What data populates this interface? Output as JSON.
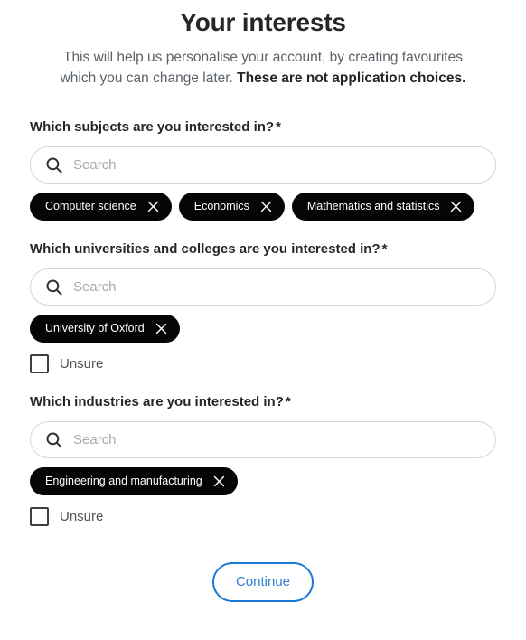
{
  "header": {
    "title": "Your interests",
    "subtitle_normal": "This will help us personalise your account, by creating favourites which you can change later. ",
    "subtitle_strong": "These are not application choices."
  },
  "sections": [
    {
      "label": "Which subjects are you interested in?",
      "required_marker": "*",
      "search": {
        "placeholder": "Search",
        "value": "",
        "icon": "search-icon"
      },
      "chips": [
        {
          "label": "Computer science",
          "remove_icon": "close-icon"
        },
        {
          "label": "Economics",
          "remove_icon": "close-icon"
        },
        {
          "label": "Mathematics and statistics",
          "remove_icon": "close-icon"
        }
      ],
      "unsure": null
    },
    {
      "label": "Which universities and colleges are you interested in?",
      "required_marker": "*",
      "search": {
        "placeholder": "Search",
        "value": "",
        "icon": "search-icon"
      },
      "chips": [
        {
          "label": "University of Oxford",
          "remove_icon": "close-icon"
        }
      ],
      "unsure": {
        "label": "Unsure",
        "checked": false
      }
    },
    {
      "label": "Which industries are you interested in?",
      "required_marker": "*",
      "search": {
        "placeholder": "Search",
        "value": "",
        "icon": "search-icon"
      },
      "chips": [
        {
          "label": "Engineering and manufacturing",
          "remove_icon": "close-icon"
        }
      ],
      "unsure": {
        "label": "Unsure",
        "checked": false
      }
    }
  ],
  "footer": {
    "continue_label": "Continue"
  },
  "colors": {
    "chip_background": "#050505",
    "chip_text": "#ffffff",
    "accent_blue": "#1a79d6",
    "title_text": "#24272a",
    "subtitle_text": "#5b6269",
    "input_border": "#d4d6d8",
    "placeholder_text": "#a7aaad",
    "page_background": "#ffffff"
  }
}
